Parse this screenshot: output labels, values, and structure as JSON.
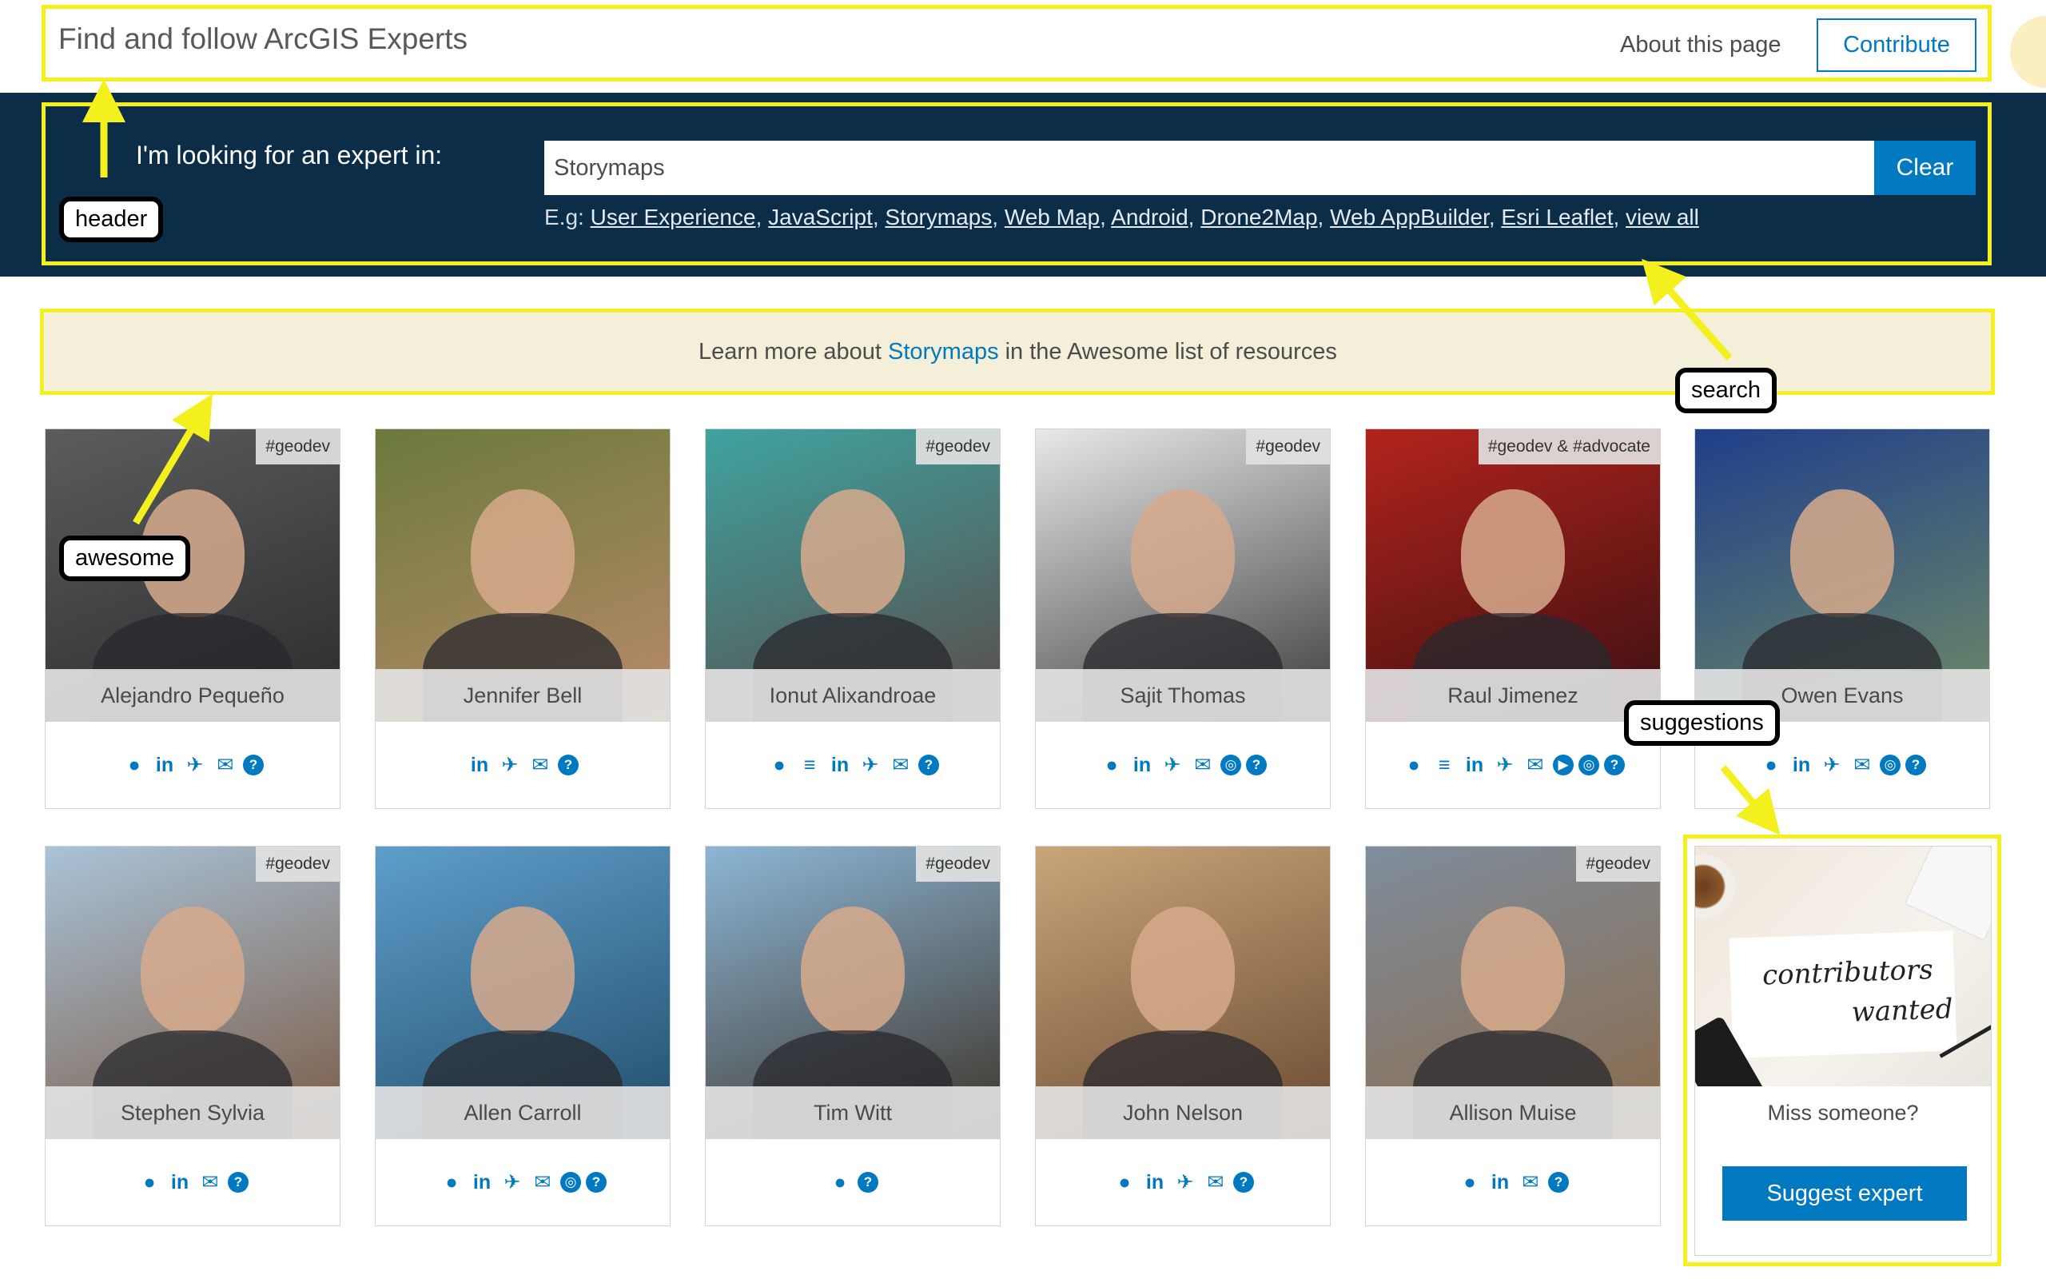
{
  "header": {
    "title": "Find and follow ArcGIS Experts",
    "about_label": "About this page",
    "contribute_label": "Contribute"
  },
  "search": {
    "label": "I'm looking for an expert in:",
    "value": "Storymaps",
    "clear_label": "Clear",
    "examples_prefix": "E.g:",
    "examples": [
      "User Experience",
      "JavaScript",
      "Storymaps",
      "Web Map",
      "Android",
      "Drone2Map",
      "Web AppBuilder",
      "Esri Leaflet",
      "view all"
    ]
  },
  "awesome": {
    "prefix": "Learn more about",
    "topic": "Storymaps",
    "suffix": "in the Awesome list of resources"
  },
  "experts": [
    {
      "name": "Alejandro Pequeño",
      "tag": "#geodev",
      "links": [
        "github-icon",
        "linkedin-icon",
        "twitter-icon",
        "chat-icon",
        "help-icon"
      ],
      "colors": [
        "#5a5c5e",
        "#2a2b2d"
      ]
    },
    {
      "name": "Jennifer Bell",
      "tag": "",
      "links": [
        "linkedin-icon",
        "twitter-icon",
        "chat-icon",
        "help-icon"
      ],
      "colors": [
        "#6b7a3c",
        "#b98a6a"
      ]
    },
    {
      "name": "Ionut Alixandroae",
      "tag": "#geodev",
      "links": [
        "github-icon",
        "stackoverflow-icon",
        "linkedin-icon",
        "twitter-icon",
        "chat-icon",
        "help-icon"
      ],
      "colors": [
        "#3fa3a0",
        "#5a4a48"
      ]
    },
    {
      "name": "Sajit Thomas",
      "tag": "#geodev",
      "links": [
        "github-icon",
        "linkedin-icon",
        "twitter-icon",
        "chat-icon",
        "globe-icon",
        "help-icon"
      ],
      "colors": [
        "#e8e8e8",
        "#3b3b3b"
      ]
    },
    {
      "name": "Raul Jimenez",
      "tag": "#geodev & #advocate",
      "links": [
        "github-icon",
        "stackoverflow-icon",
        "linkedin-icon",
        "twitter-icon",
        "chat-icon",
        "youtube-icon",
        "globe-icon",
        "help-icon"
      ],
      "colors": [
        "#b3231d",
        "#3a1010"
      ]
    },
    {
      "name": "Owen Evans",
      "tag": "",
      "links": [
        "github-icon",
        "linkedin-icon",
        "twitter-icon",
        "chat-icon",
        "globe-icon",
        "help-icon"
      ],
      "colors": [
        "#1f3f8a",
        "#6f8a66"
      ]
    },
    {
      "name": "Stephen Sylvia",
      "tag": "#geodev",
      "links": [
        "github-icon",
        "linkedin-icon",
        "chat-icon",
        "help-icon"
      ],
      "colors": [
        "#a9c3d8",
        "#7a5a44"
      ]
    },
    {
      "name": "Allen Carroll",
      "tag": "",
      "links": [
        "github-icon",
        "linkedin-icon",
        "twitter-icon",
        "chat-icon",
        "globe-icon",
        "help-icon"
      ],
      "colors": [
        "#5e9ecb",
        "#214d6b"
      ]
    },
    {
      "name": "Tim Witt",
      "tag": "#geodev",
      "links": [
        "github-icon",
        "help-icon"
      ],
      "colors": [
        "#8cb6d6",
        "#3d3328"
      ]
    },
    {
      "name": "John Nelson",
      "tag": "",
      "links": [
        "github-icon",
        "linkedin-icon",
        "twitter-icon",
        "chat-icon",
        "help-icon"
      ],
      "colors": [
        "#c9a57a",
        "#6a4a32"
      ]
    },
    {
      "name": "Allison Muise",
      "tag": "#geodev",
      "links": [
        "github-icon",
        "linkedin-icon",
        "chat-icon",
        "help-icon"
      ],
      "colors": [
        "#7f8d9c",
        "#8a6a4a"
      ]
    }
  ],
  "suggest": {
    "image_line1": "contributors",
    "image_line2": "wanted",
    "prompt": "Miss someone?",
    "button_label": "Suggest expert"
  },
  "annotations": {
    "header": "header",
    "search": "search",
    "awesome": "awesome",
    "suggestions": "suggestions",
    "highlight_color": "#f4f01e"
  },
  "colors": {
    "accent": "#0079c1",
    "band": "#0b2d48",
    "banner": "#f4efd8"
  }
}
